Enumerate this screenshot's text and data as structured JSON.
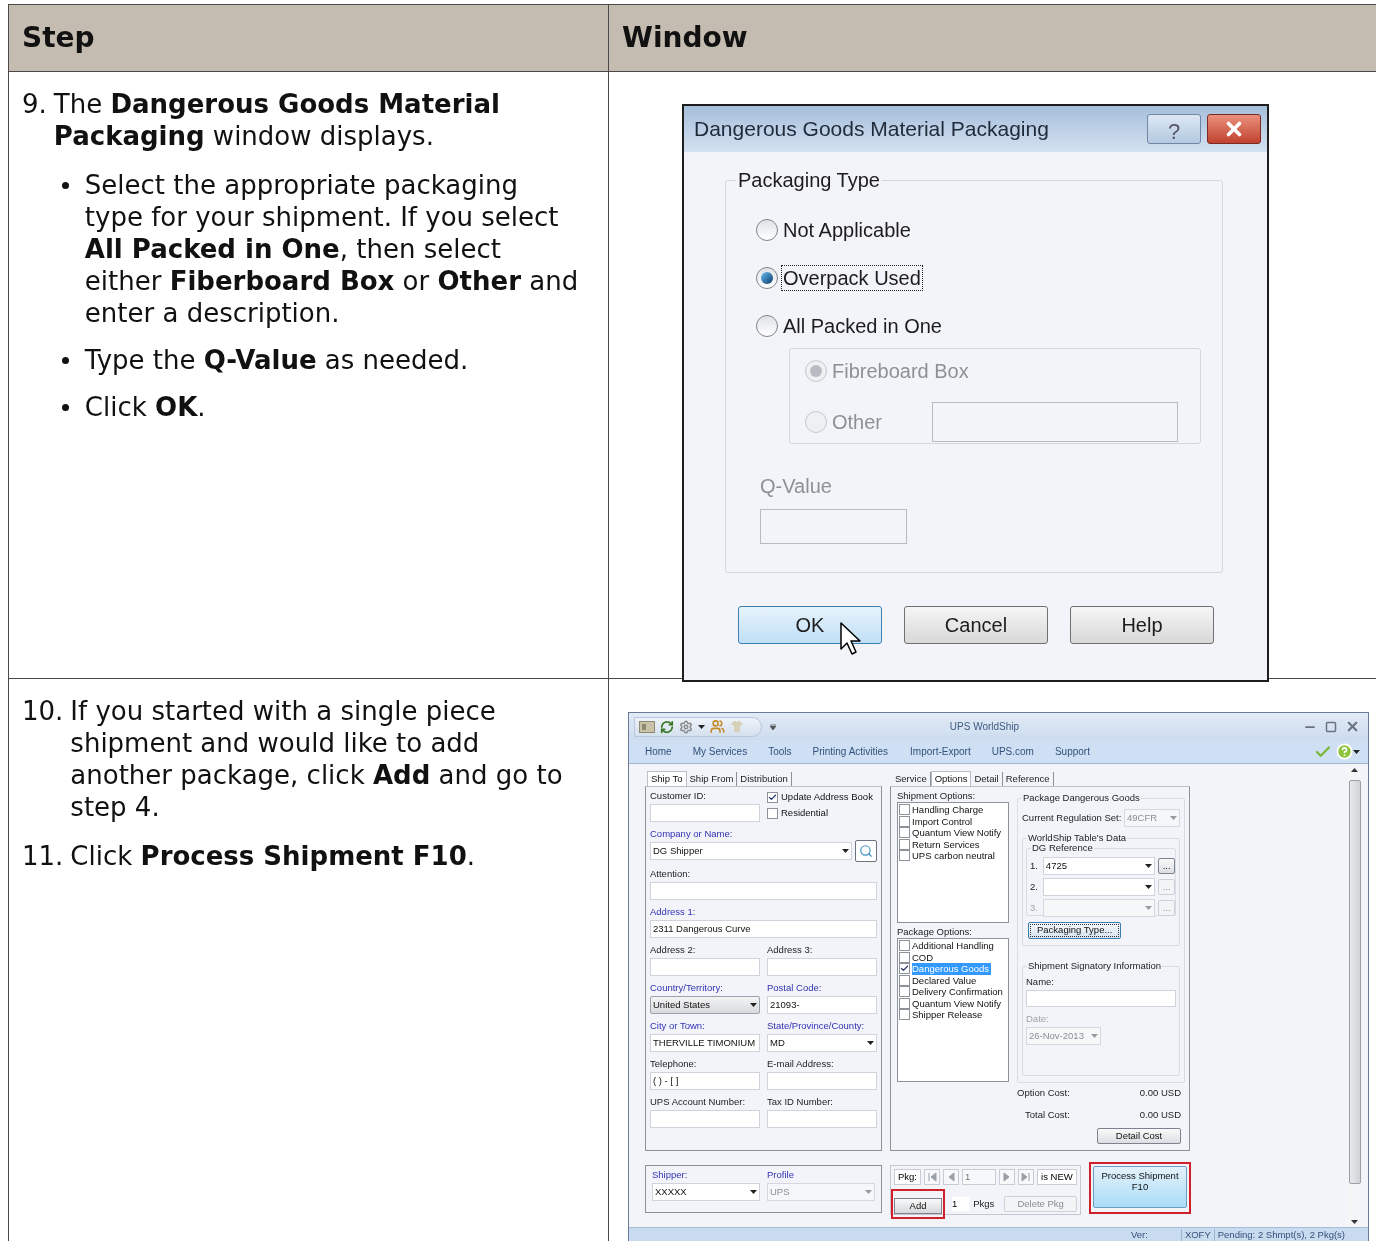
{
  "table": {
    "columns": [
      "Step",
      "Window"
    ],
    "rows": [
      {
        "steps": [
          {
            "number": "9.",
            "text": "The **Dangerous Goods Material Packaging** window displays.",
            "bullets": [
              "Select the appropriate packaging type for your shipment. If you select **All Packed in One**, then select either **Fiberboard Box** or **Other** and enter a description.",
              "Type the **Q-Value** as needed.",
              "Click **OK**."
            ]
          }
        ],
        "window": {
          "kind": "dialog",
          "title": "Dangerous Goods Material Packaging",
          "help_glyph": "?",
          "group_title": "Packaging Type",
          "options": [
            {
              "label": "Not Applicable",
              "selected": false,
              "focused": false,
              "disabled": false
            },
            {
              "label": "Overpack Used",
              "selected": true,
              "focused": true,
              "disabled": false
            },
            {
              "label": "All Packed in One",
              "selected": false,
              "focused": false,
              "disabled": false,
              "children": [
                {
                  "label": "Fibreboard Box",
                  "selected": true,
                  "focused": false,
                  "disabled": true,
                  "kind": "radio"
                },
                {
                  "label": "Other",
                  "selected": false,
                  "focused": false,
                  "disabled": true,
                  "kind": "radio_with_field"
                }
              ]
            }
          ],
          "q_value": {
            "label": "Q-Value",
            "disabled": true
          },
          "buttons": [
            {
              "label": "OK",
              "default": true
            },
            {
              "label": "Cancel",
              "default": false
            },
            {
              "label": "Help",
              "default": false
            }
          ]
        }
      },
      {
        "steps": [
          {
            "number": "10.",
            "text": "If you started with a single piece shipment and would like to add another package, click **Add** and go to step 4."
          },
          {
            "number": "11.",
            "text": "Click **Process Shipment F10**."
          }
        ],
        "window": {
          "kind": "app",
          "title": "UPS WorldShip",
          "menu": [
            "Home",
            "My Services",
            "Tools",
            "Printing Activities",
            "Import-Export",
            "UPS.com",
            "Support"
          ],
          "left_tabs": [
            {
              "label": "Ship To",
              "selected": true
            },
            {
              "label": "Ship From",
              "selected": false
            },
            {
              "label": "Distribution",
              "selected": false
            }
          ],
          "address_rows": [
            [
              {
                "kind": "text",
                "label": "Customer ID:",
                "required": false
              },
              {
                "kind": "checks",
                "items": [
                  {
                    "label": "Update Address Book",
                    "checked": true
                  },
                  {
                    "label": "Residential",
                    "checked": false
                  }
                ]
              }
            ],
            [
              {
                "kind": "lookup",
                "label": "Company or Name:",
                "required": true,
                "value": "DG Shipper"
              }
            ],
            [
              {
                "kind": "text",
                "label": "Attention:",
                "required": false
              }
            ],
            [
              {
                "kind": "text",
                "label": "Address 1:",
                "required": true,
                "value": "2311 Dangerous Curve"
              }
            ],
            [
              {
                "kind": "text",
                "label": "Address 2:",
                "required": false
              },
              {
                "kind": "text",
                "label": "Address 3:",
                "required": false
              }
            ],
            [
              {
                "kind": "combo",
                "label": "Country/Territory:",
                "required": true,
                "value": "United States"
              },
              {
                "kind": "text",
                "label": "Postal Code:",
                "required": true,
                "value": "21093-"
              }
            ],
            [
              {
                "kind": "text",
                "label": "City or Town:",
                "required": true,
                "value": "THERVILLE TIMONIUM"
              },
              {
                "kind": "dropdown",
                "label": "State/Province/County:",
                "required": true,
                "value": "MD"
              }
            ],
            [
              {
                "kind": "text",
                "label": "Telephone:",
                "required": false,
                "value": "( )  -  [ ]"
              },
              {
                "kind": "text",
                "label": "E-mail Address:",
                "required": false
              }
            ],
            [
              {
                "kind": "text",
                "label": "UPS Account Number:",
                "required": false
              },
              {
                "kind": "text",
                "label": "Tax ID Number:",
                "required": false
              }
            ]
          ],
          "bottom_fields": [
            {
              "label": "Shipper:",
              "value": "XXXXX",
              "disabled": false
            },
            {
              "label": "Profile",
              "value": "UPS",
              "disabled": true
            }
          ],
          "right_tabs": [
            {
              "label": "Service",
              "selected": false
            },
            {
              "label": "Options",
              "selected": true
            },
            {
              "label": "Detail",
              "selected": false
            },
            {
              "label": "Reference",
              "selected": false
            }
          ],
          "shipment_options": {
            "title": "Shipment Options:",
            "items": [
              {
                "label": "Handling Charge",
                "checked": false,
                "selected": false
              },
              {
                "label": "Import Control",
                "checked": false,
                "selected": false
              },
              {
                "label": "Quantum View Notify",
                "checked": false,
                "selected": false
              },
              {
                "label": "Return Services",
                "checked": false,
                "selected": false
              },
              {
                "label": "UPS carbon neutral",
                "checked": false,
                "selected": false
              }
            ]
          },
          "package_options": {
            "title": "Package Options:",
            "items": [
              {
                "label": "Additional Handling",
                "checked": false,
                "selected": false
              },
              {
                "label": "COD",
                "checked": false,
                "selected": false
              },
              {
                "label": "Dangerous Goods",
                "checked": true,
                "selected": true
              },
              {
                "label": "Declared Value",
                "checked": false,
                "selected": false
              },
              {
                "label": "Delivery Confirmation",
                "checked": false,
                "selected": false
              },
              {
                "label": "Quantum View Notify",
                "checked": false,
                "selected": false
              },
              {
                "label": "Shipper Release",
                "checked": false,
                "selected": false
              }
            ]
          },
          "dg": {
            "title": "Package Dangerous Goods",
            "regulation": {
              "label": "Current Regulation Set:",
              "value": "49CFR",
              "disabled": true
            },
            "table_title": "WorldShip Table's Data",
            "reference_title": "DG Reference",
            "references": [
              {
                "number": "1.",
                "value": "4725",
                "disabled": false,
                "button": "..."
              },
              {
                "number": "2.",
                "disabled": false,
                "button": "..."
              },
              {
                "number": "3.",
                "disabled": true,
                "button": "..."
              }
            ],
            "packaging_button": "Packaging Type...",
            "signatory_title": "Shipment Signatory Information",
            "name_label": "Name:",
            "date": {
              "label": "Date:",
              "value": "26-Nov-2013",
              "disabled": true
            }
          },
          "costs": [
            {
              "label": "Option Cost:",
              "value": "0.00 USD"
            },
            {
              "label": "Total Cost:",
              "value": "0.00 USD"
            }
          ],
          "detail_button": "Detail Cost",
          "package_nav": {
            "label": "Pkg:",
            "current": "1",
            "status": "is NEW"
          },
          "add_button": {
            "label": "Add",
            "highlighted": true
          },
          "package_count": "1",
          "package_count_label": "Pkgs",
          "delete_button": {
            "label": "Delete Pkg",
            "disabled": true
          },
          "process_button": {
            "label": "Process Shipment F10",
            "highlighted": true
          },
          "status_bar": [
            "Ver:",
            "XOFY",
            "Pending: 2 Shmpt(s), 2 Pkg(s)"
          ]
        }
      }
    ]
  }
}
